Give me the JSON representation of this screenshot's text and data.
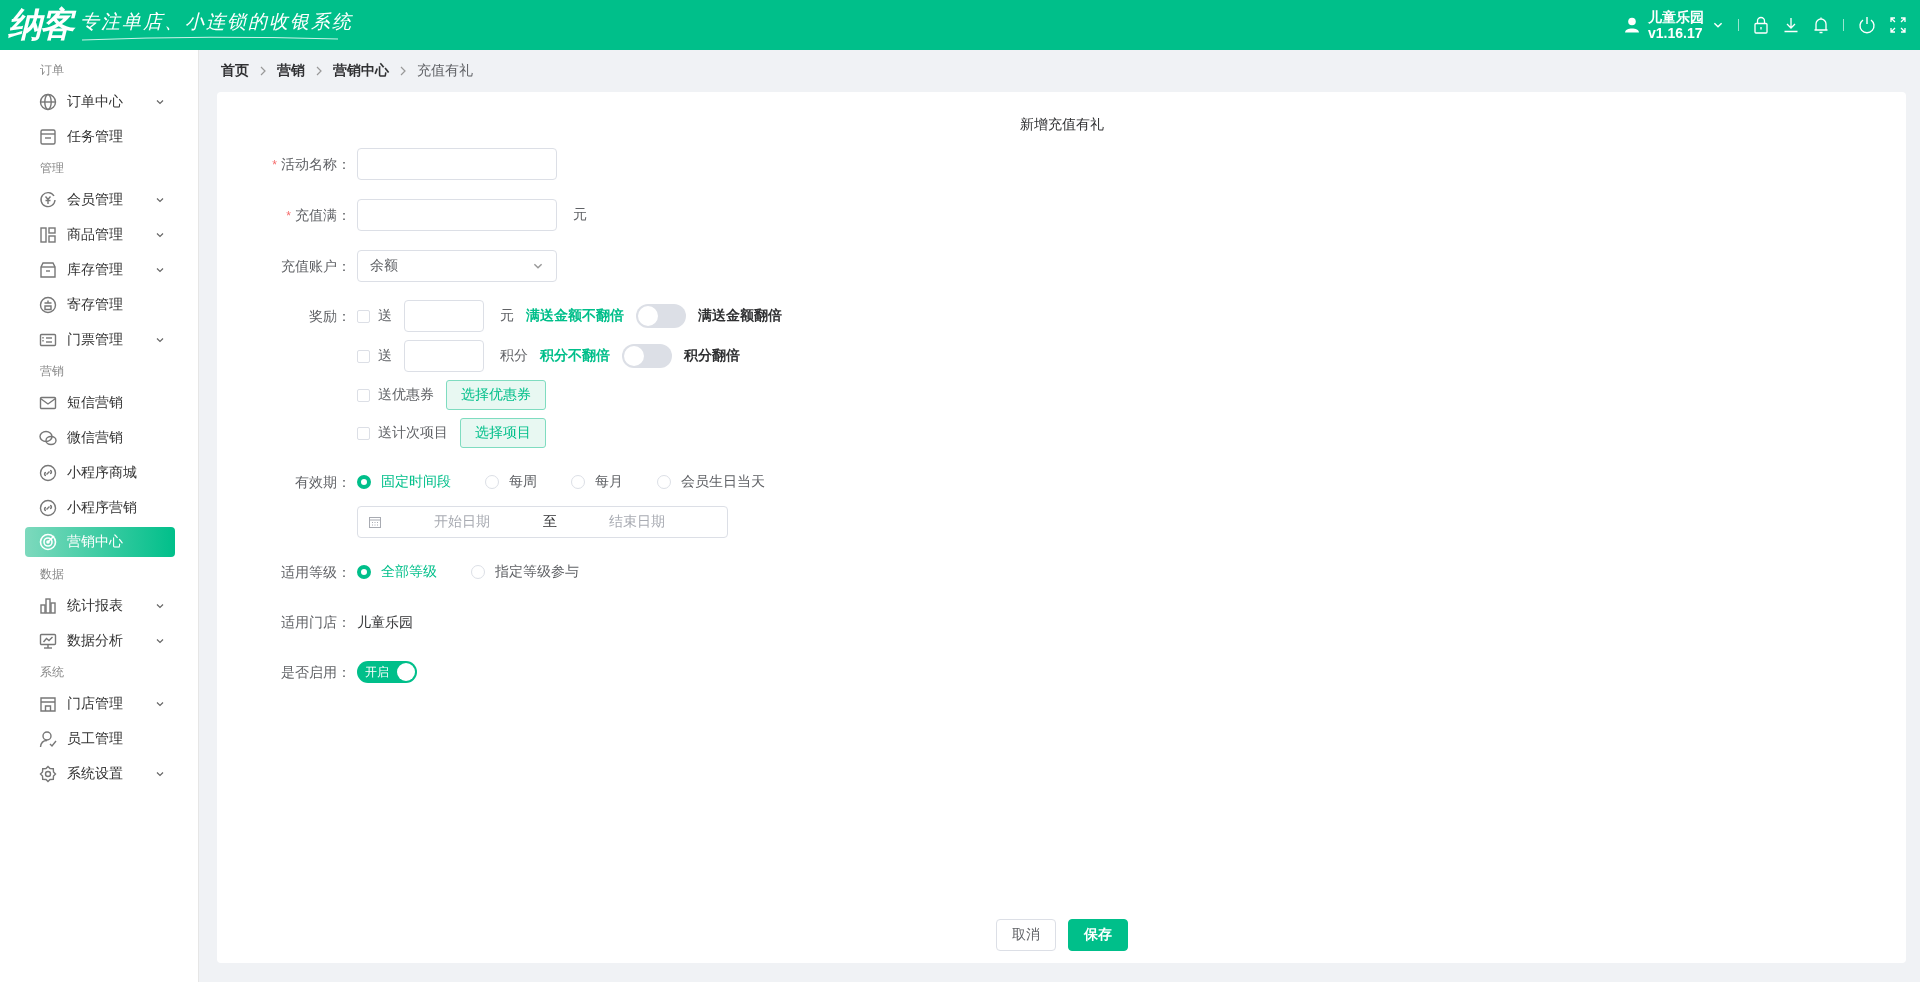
{
  "header": {
    "logo": "纳客",
    "slogan": "专注单店、小连锁的收银系统",
    "user": {
      "name": "儿童乐园",
      "version": "v1.16.17"
    }
  },
  "sidebar": {
    "sections": [
      {
        "title": "订单",
        "items": [
          {
            "label": "订单中心",
            "expandable": true,
            "selected": false
          },
          {
            "label": "任务管理",
            "expandable": false,
            "selected": false
          }
        ]
      },
      {
        "title": "管理",
        "items": [
          {
            "label": "会员管理",
            "expandable": true,
            "selected": false
          },
          {
            "label": "商品管理",
            "expandable": true,
            "selected": false
          },
          {
            "label": "库存管理",
            "expandable": true,
            "selected": false
          },
          {
            "label": "寄存管理",
            "expandable": false,
            "selected": false
          },
          {
            "label": "门票管理",
            "expandable": true,
            "selected": false
          }
        ]
      },
      {
        "title": "营销",
        "items": [
          {
            "label": "短信营销",
            "expandable": false,
            "selected": false
          },
          {
            "label": "微信营销",
            "expandable": false,
            "selected": false
          },
          {
            "label": "小程序商城",
            "expandable": false,
            "selected": false
          },
          {
            "label": "小程序营销",
            "expandable": false,
            "selected": false
          },
          {
            "label": "营销中心",
            "expandable": false,
            "selected": true
          }
        ]
      },
      {
        "title": "数据",
        "items": [
          {
            "label": "统计报表",
            "expandable": true,
            "selected": false
          },
          {
            "label": "数据分析",
            "expandable": true,
            "selected": false
          }
        ]
      },
      {
        "title": "系统",
        "items": [
          {
            "label": "门店管理",
            "expandable": true,
            "selected": false
          },
          {
            "label": "员工管理",
            "expandable": false,
            "selected": false
          },
          {
            "label": "系统设置",
            "expandable": true,
            "selected": false
          }
        ]
      }
    ]
  },
  "breadcrumb": [
    {
      "label": "首页",
      "current": false
    },
    {
      "label": "营销",
      "current": false
    },
    {
      "label": "营销中心",
      "current": false
    },
    {
      "label": "充值有礼",
      "current": true
    }
  ],
  "form": {
    "title": "新增充值有礼",
    "fields": [
      {
        "kind": "input",
        "label": "活动名称：",
        "required_mark": "*"
      },
      {
        "kind": "input",
        "label": "充值满：",
        "required_mark": "*",
        "unit": "元"
      },
      {
        "kind": "select",
        "label": "充值账户：",
        "value": "余额"
      },
      {
        "kind": "rewards",
        "label": "奖励：",
        "rows": [
          {
            "kind": "amount",
            "checked": false,
            "text": "送",
            "unit": "元",
            "off_label": "满送金额不翻倍",
            "on": false,
            "on_label": "满送金额翻倍"
          },
          {
            "kind": "amount",
            "checked": false,
            "text": "送",
            "unit": "积分",
            "off_label": "积分不翻倍",
            "on": false,
            "on_label": "积分翻倍"
          },
          {
            "kind": "picker",
            "checked": false,
            "text": "送优惠券",
            "button": "选择优惠券"
          },
          {
            "kind": "picker",
            "checked": false,
            "text": "送计次项目",
            "button": "选择项目"
          }
        ]
      },
      {
        "kind": "radios",
        "label": "有效期：",
        "options": [
          {
            "label": "固定时间段",
            "selected": true
          },
          {
            "label": "每周",
            "selected": false
          },
          {
            "label": "每月",
            "selected": false
          },
          {
            "label": "会员生日当天",
            "selected": false
          }
        ],
        "date_range": {
          "start_placeholder": "开始日期",
          "separator": "至",
          "end_placeholder": "结束日期"
        }
      },
      {
        "kind": "radios",
        "label": "适用等级：",
        "options": [
          {
            "label": "全部等级",
            "selected": true
          },
          {
            "label": "指定等级参与",
            "selected": false
          }
        ]
      },
      {
        "kind": "static",
        "label": "适用门店：",
        "value": "儿童乐园"
      },
      {
        "kind": "switch",
        "label": "是否启用：",
        "on": true,
        "text": "开启"
      }
    ]
  },
  "buttons": [
    {
      "label": "取消",
      "kind": "default"
    },
    {
      "label": "保存",
      "kind": "primary"
    }
  ]
}
